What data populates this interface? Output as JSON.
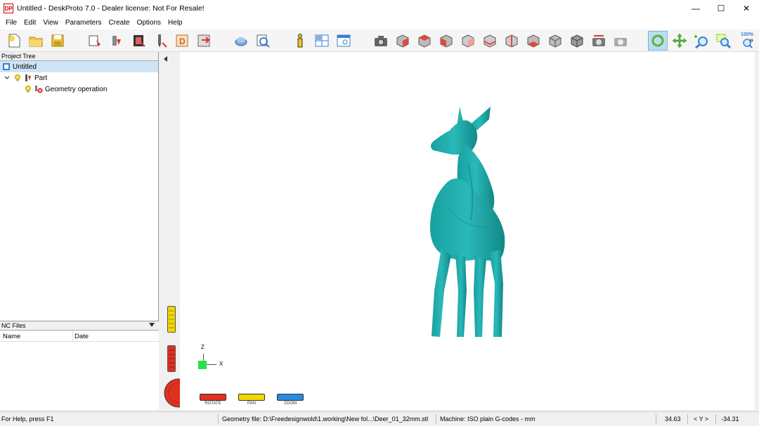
{
  "window": {
    "title": "Untitled - DeskProto 7.0 - Dealer license: Not For Resale!",
    "logo_text": "DP",
    "minimize": "—",
    "maximize": "☐",
    "close": "✕"
  },
  "menu": {
    "items": [
      "File",
      "Edit",
      "View",
      "Parameters",
      "Create",
      "Options",
      "Help"
    ]
  },
  "toolbar": {
    "zoom_level": "100%",
    "overflow": "»"
  },
  "project_tree": {
    "header": "Project Tree",
    "root": "Untitled",
    "part": "Part",
    "operation": "Geometry operation"
  },
  "nc_files": {
    "header": "NC Files",
    "col_name": "Name",
    "col_date": "Date"
  },
  "viewport": {
    "axis_z": "Z",
    "axis_x": "X",
    "model_color": "#1fa8a8"
  },
  "controls": {
    "rotate": "ROTATE",
    "pan": "PAN",
    "zoom": "ZOOM"
  },
  "status": {
    "help": "For Help, press F1",
    "geometry_file": "Geometry file: D:\\Freedesignwold\\1.working\\New fol...\\Deer_01_32mm.stl",
    "machine": "Machine: ISO plain G-codes - mm",
    "x_value": "34.63",
    "y_label": "< Y >",
    "y_value": "-34.31"
  },
  "colors": {
    "accent_blue": "#3a7fd0",
    "selection": "#cde4f7",
    "red_cube": "#e04a3a"
  }
}
